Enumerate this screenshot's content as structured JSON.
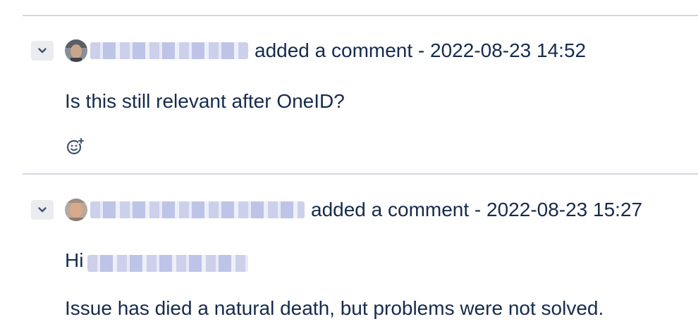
{
  "comments": [
    {
      "author_name": "Dash, James [UK]",
      "action": "added a comment",
      "separator": "-",
      "timestamp": "2022-08-23 14:52",
      "body": "Is this still relevant after OneID?",
      "toggle_icon": "chevron-down-icon",
      "reaction_icon": "add-reaction-icon"
    },
    {
      "author_name": "Tomasz Cyclops [LSI]",
      "action": "added a comment",
      "separator": "-",
      "timestamp": "2022-08-23 15:27",
      "greeting": "Hi",
      "mention": "Dash, James [UK]",
      "body": "Issue has died a natural death, but problems were not solved.",
      "toggle_icon": "chevron-down-icon"
    }
  ],
  "colors": {
    "text": "#172b4d",
    "divider": "#d3d6e0",
    "toggle_bg": "#ebecf0"
  }
}
